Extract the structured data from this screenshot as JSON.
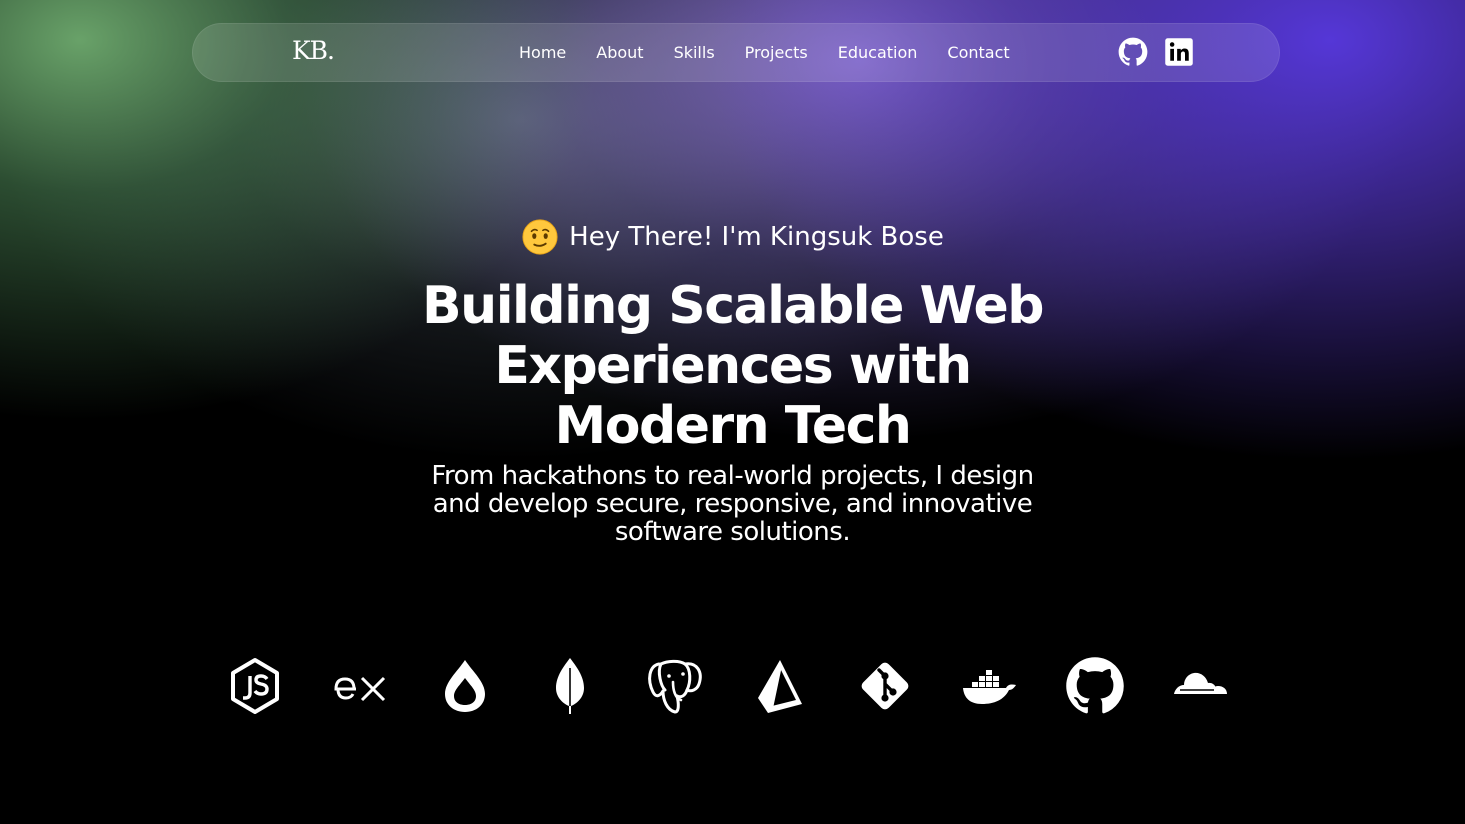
{
  "nav": {
    "logo": "KB.",
    "links": [
      "Home",
      "About",
      "Skills",
      "Projects",
      "Education",
      "Contact"
    ],
    "social": [
      "github-icon",
      "linkedin-icon"
    ]
  },
  "hero": {
    "greeting_emoji": "face-icon",
    "greeting": "Hey There! I'm Kingsuk Bose",
    "headline": [
      "Building Scalable Web",
      "Experiences with",
      "Modern Tech"
    ],
    "subtext": [
      "From hackathons to real-world projects, I design",
      "and develop secure, responsive, and innovative",
      "software solutions."
    ]
  },
  "tech_stack": [
    "nodejs-icon",
    "express-icon",
    "drop-icon",
    "mongodb-icon",
    "postgresql-icon",
    "prisma-icon",
    "git-icon",
    "docker-icon",
    "github-icon",
    "cloudflare-icon"
  ],
  "colors": {
    "background": "#000000",
    "accent_purple": "#5537d7",
    "accent_green": "#6eaa6e",
    "text": "#ffffff"
  }
}
